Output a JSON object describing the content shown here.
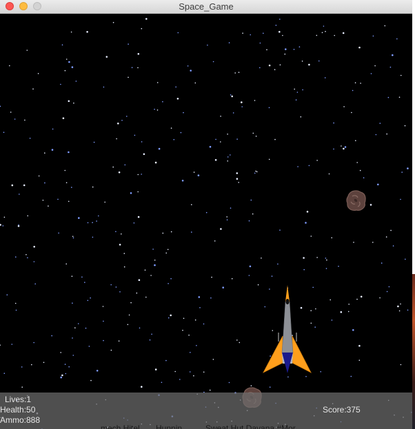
{
  "window": {
    "title": "Space_Game"
  },
  "hud": {
    "lives": "Lives:1",
    "health": "Health:50",
    "ammo": "Ammo:888",
    "score": "Score:375"
  },
  "background_window_text": {
    "fragment_1": "mech Hitel",
    "fragment_2": "Hunnin",
    "fragment_3": "Sweat Hut Davana #Mor"
  },
  "colors": {
    "space": "#000000",
    "stars": "#cfe0ff",
    "ship_wing": "#ff9f1c",
    "ship_body": "#8d9096",
    "ship_nose": "#1a1a8c",
    "asteroid": "#6b4f4a"
  }
}
